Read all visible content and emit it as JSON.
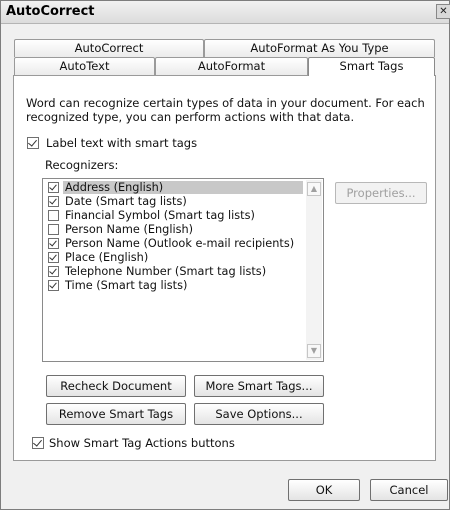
{
  "window": {
    "title": "AutoCorrect",
    "close_glyph": "✕"
  },
  "tabs": {
    "row1": [
      "AutoCorrect",
      "AutoFormat As You Type"
    ],
    "row2": [
      "AutoText",
      "AutoFormat",
      "Smart Tags"
    ],
    "active": "Smart Tags"
  },
  "smart_tags": {
    "description_line1": "Word can recognize certain types of data in your document. For each",
    "description_line2": "recognized type, you can perform actions with that data.",
    "label_checkbox": {
      "label": "Label text with smart tags",
      "checked": true
    },
    "recognizers_label": "Recognizers:",
    "recognizers": [
      {
        "label": "Address (English)",
        "checked": true,
        "selected": true
      },
      {
        "label": "Date (Smart tag lists)",
        "checked": true,
        "selected": false
      },
      {
        "label": "Financial Symbol (Smart tag lists)",
        "checked": false,
        "selected": false
      },
      {
        "label": "Person Name (English)",
        "checked": false,
        "selected": false
      },
      {
        "label": "Person Name (Outlook e-mail recipients)",
        "checked": true,
        "selected": false
      },
      {
        "label": "Place (English)",
        "checked": true,
        "selected": false
      },
      {
        "label": "Telephone Number (Smart tag lists)",
        "checked": true,
        "selected": false
      },
      {
        "label": "Time (Smart tag lists)",
        "checked": true,
        "selected": false
      }
    ],
    "properties_button": "Properties...",
    "recheck_button": "Recheck Document",
    "more_tags_button": "More Smart Tags...",
    "remove_button": "Remove Smart Tags",
    "save_options_button": "Save Options...",
    "show_actions_checkbox": {
      "label": "Show Smart Tag Actions buttons",
      "checked": true
    }
  },
  "footer": {
    "ok_label": "OK",
    "cancel_label": "Cancel"
  }
}
